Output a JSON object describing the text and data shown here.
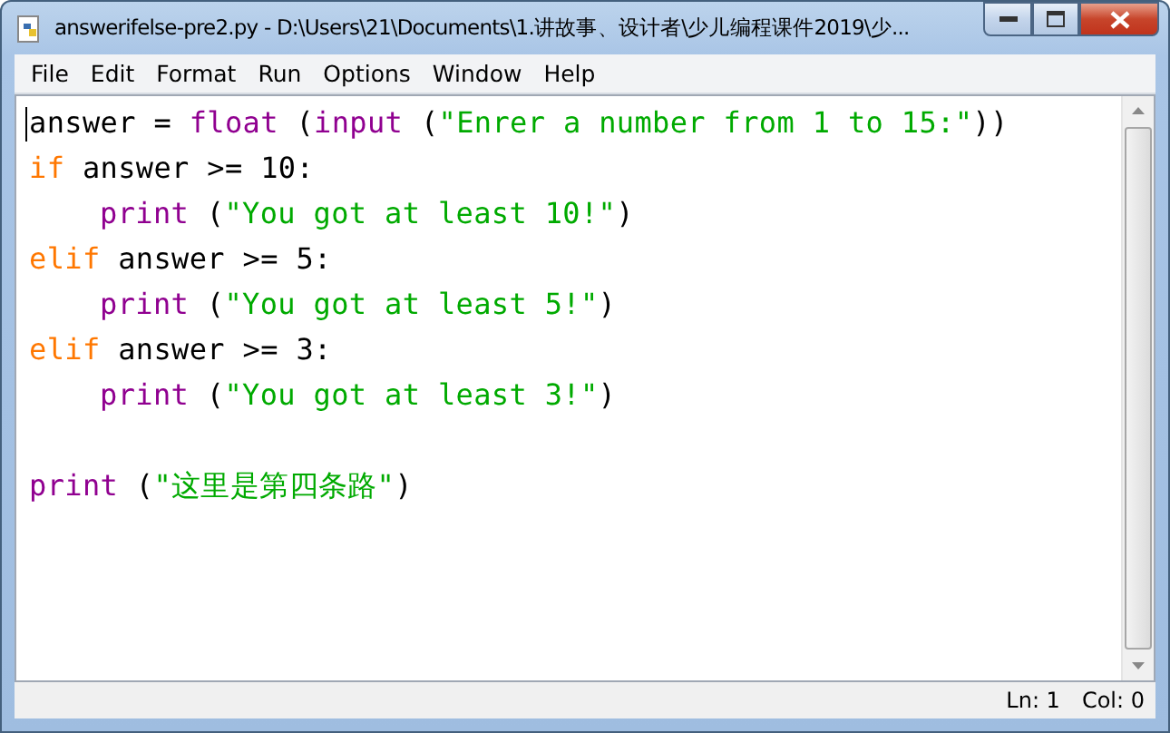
{
  "window": {
    "title": "answerifelse-pre2.py - D:\\Users\\21\\Documents\\1.讲故事、设计者\\少儿编程课件2019\\少..."
  },
  "menu": [
    "File",
    "Edit",
    "Format",
    "Run",
    "Options",
    "Window",
    "Help"
  ],
  "code_lines": [
    {
      "kind": "code",
      "tokens": [
        {
          "kind": "plain",
          "text": "answer = "
        },
        {
          "kind": "builtin",
          "text": "float"
        },
        {
          "kind": "plain",
          "text": " ("
        },
        {
          "kind": "builtin",
          "text": "input"
        },
        {
          "kind": "plain",
          "text": " ("
        },
        {
          "kind": "string",
          "text": "\"Enrer a number from 1 to 15:\""
        },
        {
          "kind": "plain",
          "text": "))"
        }
      ]
    },
    {
      "kind": "code",
      "tokens": [
        {
          "kind": "keyword",
          "text": "if"
        },
        {
          "kind": "plain",
          "text": " answer >= 10:"
        }
      ],
      "children": [
        {
          "kind": "code",
          "tokens": [
            {
              "kind": "builtin",
              "text": "print"
            },
            {
              "kind": "plain",
              "text": " ("
            },
            {
              "kind": "string",
              "text": "\"You got at least 10!\""
            },
            {
              "kind": "plain",
              "text": ")"
            }
          ]
        }
      ]
    },
    {
      "kind": "code",
      "tokens": [
        {
          "kind": "keyword",
          "text": "elif"
        },
        {
          "kind": "plain",
          "text": " answer >= 5:"
        }
      ],
      "children": [
        {
          "kind": "code",
          "tokens": [
            {
              "kind": "builtin",
              "text": "print"
            },
            {
              "kind": "plain",
              "text": " ("
            },
            {
              "kind": "string",
              "text": "\"You got at least 5!\""
            },
            {
              "kind": "plain",
              "text": ")"
            }
          ]
        }
      ]
    },
    {
      "kind": "code",
      "tokens": [
        {
          "kind": "keyword",
          "text": "elif"
        },
        {
          "kind": "plain",
          "text": " answer >= 3:"
        }
      ],
      "children": [
        {
          "kind": "code",
          "tokens": [
            {
              "kind": "builtin",
              "text": "print"
            },
            {
              "kind": "plain",
              "text": " ("
            },
            {
              "kind": "string",
              "text": "\"You got at least 3!\""
            },
            {
              "kind": "plain",
              "text": ")"
            }
          ]
        }
      ]
    },
    {
      "kind": "blank"
    },
    {
      "kind": "code",
      "tokens": [
        {
          "kind": "builtin",
          "text": "print"
        },
        {
          "kind": "plain",
          "text": " ("
        },
        {
          "kind": "string",
          "text": "\"这里是第四条路\""
        },
        {
          "kind": "plain",
          "text": ")"
        }
      ]
    }
  ],
  "status_bar": {
    "line": "Ln: 1",
    "column": "Col: 0"
  }
}
